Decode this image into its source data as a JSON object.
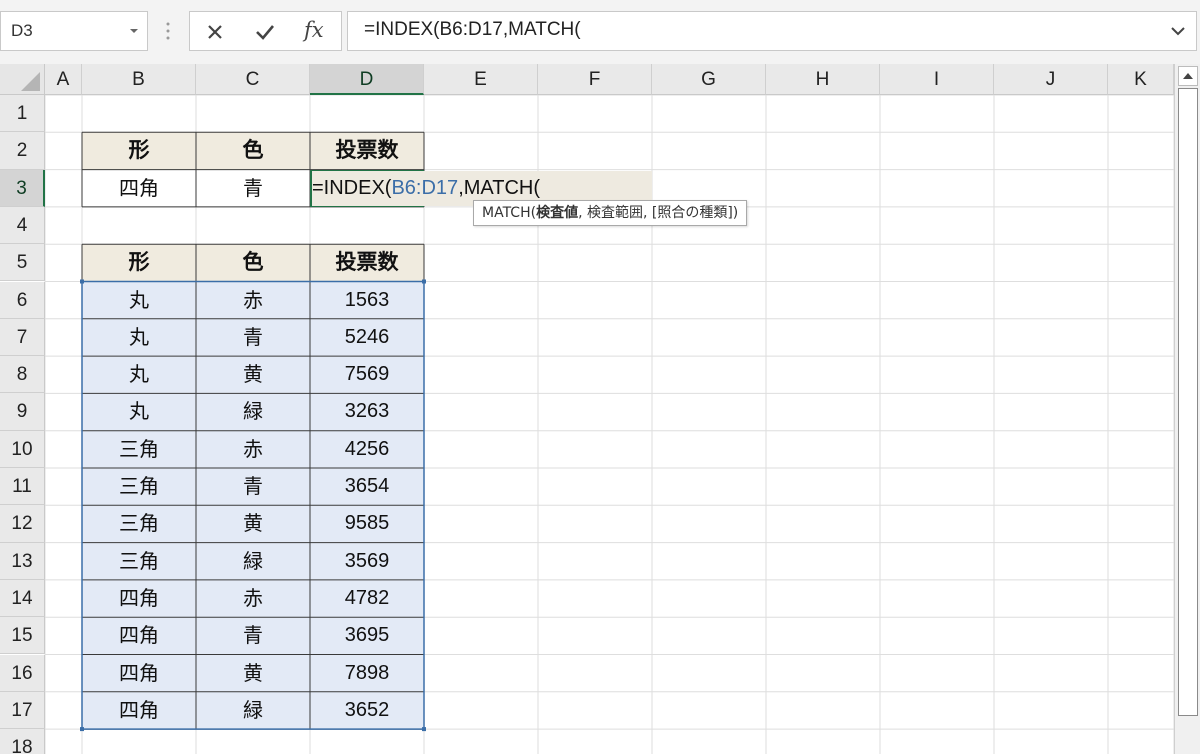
{
  "formula_bar": {
    "name_box": "D3",
    "cancel_icon": "close-icon",
    "enter_icon": "checkmark-icon",
    "fx_label": "fx",
    "formula": "=INDEX(B6:D17,MATCH("
  },
  "columns": [
    "A",
    "B",
    "C",
    "D",
    "E",
    "F",
    "G",
    "H",
    "I",
    "J",
    "K"
  ],
  "rows": [
    "1",
    "2",
    "3",
    "4",
    "5",
    "6",
    "7",
    "8",
    "9",
    "10",
    "11",
    "12",
    "13",
    "14",
    "15",
    "16",
    "17",
    "18"
  ],
  "lookup_table": {
    "headers": [
      "形",
      "色",
      "投票数"
    ],
    "shape": "四角",
    "color": "青",
    "formula_prefix": "=INDEX(",
    "formula_ref": "B6:D17",
    "formula_suffix": ",MATCH("
  },
  "data_table": {
    "headers": [
      "形",
      "色",
      "投票数"
    ],
    "rows": [
      [
        "丸",
        "赤",
        "1563"
      ],
      [
        "丸",
        "青",
        "5246"
      ],
      [
        "丸",
        "黄",
        "7569"
      ],
      [
        "丸",
        "緑",
        "3263"
      ],
      [
        "三角",
        "赤",
        "4256"
      ],
      [
        "三角",
        "青",
        "3654"
      ],
      [
        "三角",
        "黄",
        "9585"
      ],
      [
        "三角",
        "緑",
        "3569"
      ],
      [
        "四角",
        "赤",
        "4782"
      ],
      [
        "四角",
        "青",
        "3695"
      ],
      [
        "四角",
        "黄",
        "7898"
      ],
      [
        "四角",
        "緑",
        "3652"
      ]
    ]
  },
  "tooltip": {
    "func": "MATCH(",
    "arg1": "検査値",
    "rest": ", 検査範囲, [照合の種類])"
  },
  "colors": {
    "header_fill": "#f0ebdf",
    "data_fill": "#e3eaf6",
    "selection": "#217346",
    "reference": "#3b6ea8"
  }
}
